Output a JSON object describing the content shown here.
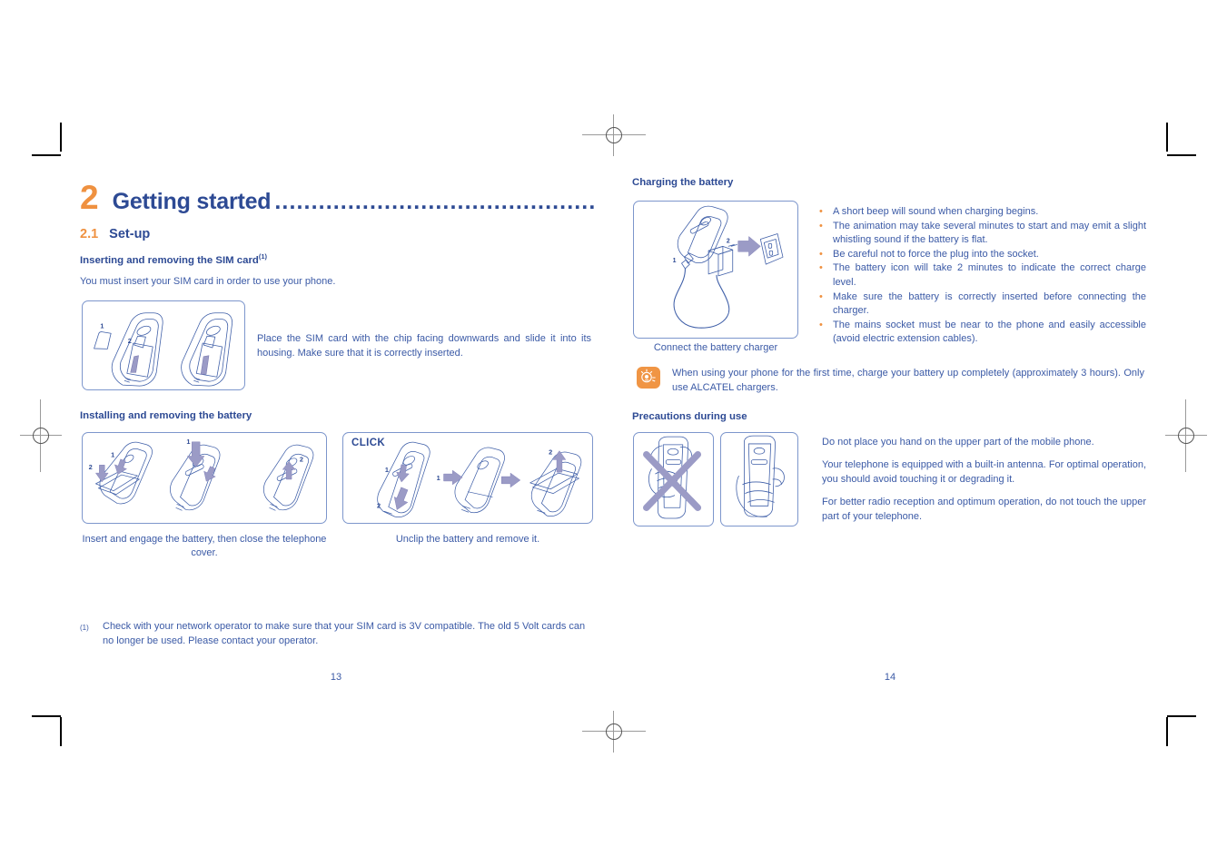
{
  "document": {
    "chapter_number": "2",
    "chapter_title": "Getting started",
    "chapter_leader": "................................................",
    "section_number": "2.1",
    "section_title": "Set-up"
  },
  "left_page": {
    "sim": {
      "heading": "Inserting and removing the SIM card",
      "heading_footnote_marker": "(1)",
      "intro": "You must insert your SIM card in order to use your phone.",
      "figure_labels": [
        "1",
        "2"
      ],
      "description": "Place the SIM card with the chip facing downwards and slide it into its housing. Make sure that it is correctly inserted."
    },
    "battery": {
      "heading": "Installing and removing the battery",
      "left_figure_labels": [
        "1",
        "2",
        "1",
        "2"
      ],
      "right_figure_click_label": "CLICK",
      "right_figure_labels": [
        "1",
        "2",
        "1",
        "2"
      ],
      "left_caption": "Insert and engage the battery, then close the telephone cover.",
      "right_caption": "Unclip the battery and remove it."
    },
    "footnote": {
      "marker": "(1)",
      "text": "Check with your network operator to make sure that your SIM card is 3V compatible. The old 5 Volt cards can no longer be used. Please contact your operator."
    },
    "page_number": "13"
  },
  "right_page": {
    "charging": {
      "heading": "Charging the battery",
      "figure_labels": [
        "1",
        "2"
      ],
      "figure_caption": "Connect the battery charger",
      "bullets": [
        "A short beep will sound when charging begins.",
        "The animation may take several minutes to start and may emit a slight whistling sound if the battery is flat.",
        "Be careful not to force the plug into the socket.",
        "The battery icon will take 2 minutes to indicate the correct charge level.",
        "Make sure the battery is correctly inserted before connecting the charger.",
        "The mains socket must be near to the phone and easily accessible (avoid electric extension cables)."
      ]
    },
    "tip": {
      "icon": "lightbulb-tip-icon",
      "text": "When using your phone for the first time, charge your battery up completely (approximately 3 hours). Only use ALCATEL chargers."
    },
    "precautions": {
      "heading": "Precautions during use",
      "paragraphs": [
        "Do not place you hand on the upper part of the mobile phone.",
        "Your telephone is equipped with a built-in antenna. For optimal operation, you should avoid touching it or degrading it.",
        "For better radio reception and optimum operation, do not touch the upper part of your telephone."
      ]
    },
    "page_number": "14"
  },
  "colors": {
    "accent_orange": "#ef9140",
    "heading_blue": "#2d4a94",
    "body_blue": "#3b5aa6",
    "line_art_blue": "#3f5fa8",
    "arrow_purple": "#8f8fc0",
    "figure_border": "#7d96cc"
  }
}
